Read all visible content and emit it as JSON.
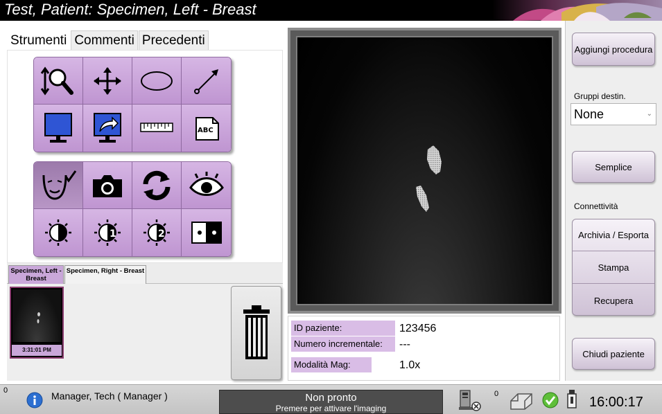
{
  "window": {
    "title": "Test, Patient:  Specimen, Left - Breast"
  },
  "tabs": [
    {
      "label": "Strumenti",
      "active": true
    },
    {
      "label": "Commenti",
      "active": false
    },
    {
      "label": "Precedenti",
      "active": false
    }
  ],
  "tools": {
    "group1": [
      "zoom-icon",
      "pan-icon",
      "ellipse-icon",
      "arrow-icon",
      "monitor-icon",
      "send-to-monitor-icon",
      "ruler-icon",
      "text-annotation-icon"
    ],
    "group2": [
      "face-check-icon",
      "camera-icon",
      "refresh-icon",
      "eye-icon",
      "contrast-icon",
      "contrast-1-icon",
      "contrast-2-icon",
      "compare-icon"
    ],
    "text_annotation_label": "ABC",
    "contrast_1_label": "1",
    "contrast_2_label": "2",
    "accent": "#c9a7d9"
  },
  "series": {
    "tabs": [
      {
        "label": "Specimen, Left - Breast",
        "active": true
      },
      {
        "label": "Specimen, Right - Breast",
        "active": false
      }
    ],
    "thumbnail_time": "3:31:01 PM"
  },
  "info": {
    "rows": [
      {
        "label": "ID paziente:",
        "value": "123456"
      },
      {
        "label": "Numero incrementale:",
        "value": "---"
      },
      {
        "label": "Modalità Mag:",
        "value": "1.0x"
      }
    ]
  },
  "right_panel": {
    "add_procedure": "Aggiungi procedura",
    "target_groups_label": "Gruppi destin.",
    "target_groups_value": "None",
    "simple": "Semplice",
    "connectivity_label": "Connettività",
    "archive_export": "Archivia / Esporta",
    "print": "Stampa",
    "retrieve": "Recupera",
    "close_patient": "Chiudi paziente"
  },
  "status": {
    "alerts_count": "0",
    "user": "Manager, Tech ( Manager )",
    "ready_title": "Non pronto",
    "ready_subtitle": "Premere per attivare l'imaging",
    "queue_count": "0",
    "time": "16:00:17"
  }
}
